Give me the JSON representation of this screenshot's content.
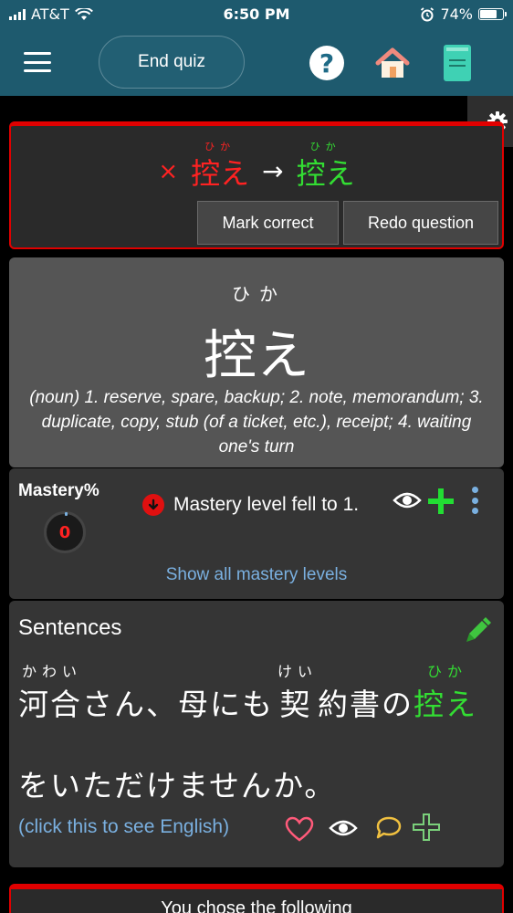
{
  "status_bar": {
    "carrier": "AT&T",
    "time": "6:50 PM",
    "battery_percent_label": "74%",
    "battery_level": 0.74
  },
  "nav": {
    "end_quiz_label": "End quiz",
    "help_glyph": "?",
    "icons": [
      "hamburger-menu-icon",
      "help-icon",
      "home-icon",
      "notebook-icon"
    ]
  },
  "settings": {
    "icon": "gear-icon"
  },
  "result": {
    "wrong_mark": "×",
    "given_answer": {
      "furigana": "ひか",
      "word": "控え"
    },
    "arrow": "→",
    "correct_answer": {
      "furigana": "ひか",
      "word": "控え"
    },
    "mark_correct_label": "Mark correct",
    "redo_label": "Redo question"
  },
  "word": {
    "furigana": "ひか",
    "kanji": "控え",
    "definition": "(noun) 1. reserve, spare, backup; 2. note, memorandum; 3. duplicate, copy, stub (of a ticket, etc.), receipt; 4. waiting one's turn"
  },
  "mastery": {
    "label": "Mastery%",
    "value": "0",
    "message": "Mastery level fell to 1.",
    "show_all_label": "Show all mastery levels"
  },
  "sentences": {
    "title": "Sentences",
    "segments": [
      {
        "furigana": "かわい",
        "text": "河合"
      },
      {
        "furigana": "",
        "text": "さん、母にも"
      },
      {
        "furigana": "けい",
        "text": "契"
      },
      {
        "furigana": "",
        "text": "約書の"
      },
      {
        "furigana": "ひか",
        "text": "控え"
      }
    ],
    "line2": "をいただけませんか。",
    "english_link": "(click this to see English)"
  },
  "bottom": {
    "text": "You chose the following"
  },
  "colors": {
    "header": "#1e5a6e",
    "wrong": "#ff2222",
    "correct": "#33dd33",
    "link": "#7ab0e0",
    "panel_border": "#e00000"
  }
}
